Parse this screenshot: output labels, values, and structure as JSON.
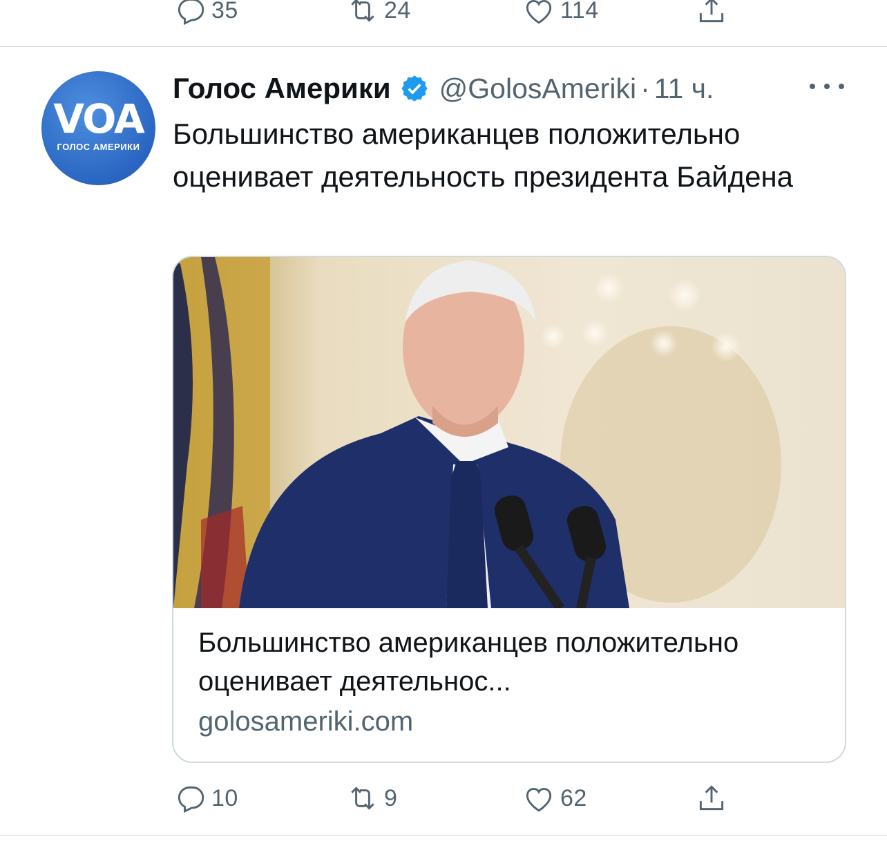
{
  "prev_tweet": {
    "actions": {
      "replies": "35",
      "retweets": "24",
      "likes": "114"
    }
  },
  "tweet": {
    "avatar": {
      "text": "VOA",
      "caption": "ГОЛОС АМЕРИКИ"
    },
    "author_name": "Голос Америки",
    "handle": "@GolosAmeriki",
    "separator": "·",
    "time": "11 ч.",
    "text": "Большинство американцев положительно оценивает деятельность президента Байдена",
    "card": {
      "image_icon": "photo-speaker-at-podium",
      "title": "Большинство американцев положительно оценивает деятельнос...",
      "domain": "golosameriki.com"
    },
    "actions": {
      "replies": "10",
      "retweets": "9",
      "likes": "62"
    }
  },
  "colors": {
    "accent": "#1d9bf0",
    "secondary_text": "#536471",
    "divider": "#cfd9de"
  }
}
